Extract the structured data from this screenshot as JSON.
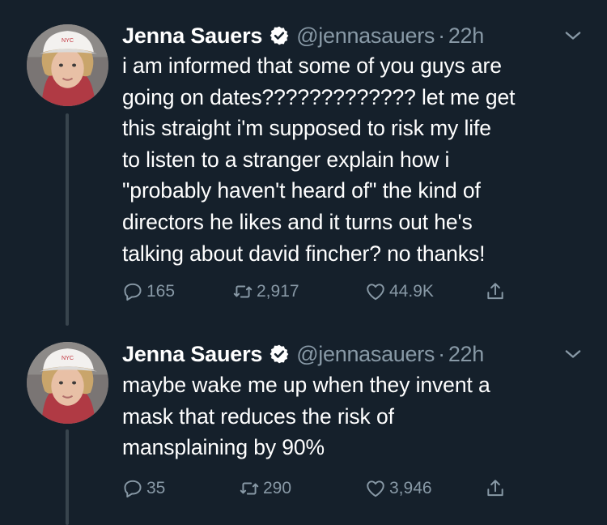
{
  "tweets": [
    {
      "name": "Jenna Sauers",
      "handle": "@jennasauers",
      "separator": "·",
      "time": "22h",
      "avatar_cap_text": "NYC",
      "text": "i am informed that some of you guys are\ngoing on dates????????????? let me get\nthis straight i'm supposed to risk my life\nto listen to a stranger explain how i\n\"probably haven't heard of\" the kind of\ndirectors he likes and it turns out he's\ntalking about david fincher? no thanks!",
      "replies": "165",
      "retweets": "2,917",
      "likes": "44.9K"
    },
    {
      "name": "Jenna Sauers",
      "handle": "@jennasauers",
      "separator": "·",
      "time": "22h",
      "avatar_cap_text": "NYC",
      "text": "maybe wake me up when they invent a\nmask that reduces the risk of\nmansplaining by 90%",
      "replies": "35",
      "retweets": "290",
      "likes": "3,946"
    }
  ],
  "colors": {
    "background": "#15202b",
    "text": "#ffffff",
    "muted": "#8899a6",
    "thread_line": "#38444d"
  },
  "icons": [
    "verified-badge-icon",
    "chevron-down-icon",
    "reply-icon",
    "retweet-icon",
    "like-icon",
    "share-icon"
  ]
}
